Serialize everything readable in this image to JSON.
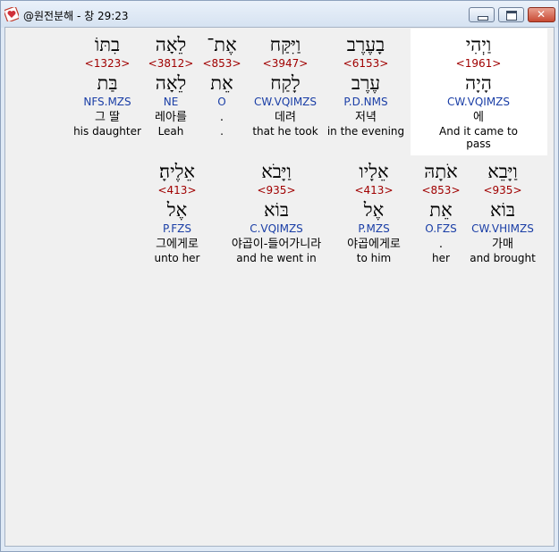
{
  "window": {
    "title": "@원전분해 - 창 29:23",
    "icon": "app-heart-icon"
  },
  "rows": [
    [
      {
        "id": "w1",
        "heb": "וַיְהִי",
        "num": "<1961>",
        "heb_root": "הָיָה",
        "morph": "CW.VQIMZS",
        "kor": "에",
        "eng": "And it came to pass"
      },
      {
        "id": "w2",
        "heb": "בָעֶרֶב",
        "num": "<6153>",
        "heb_root": "עֶרֶב",
        "morph": "P.D.NMS",
        "kor": "저녁",
        "eng": "in the evening"
      },
      {
        "id": "w3",
        "heb": "וַיִּקַּח",
        "num": "<3947>",
        "heb_root": "לָקַח",
        "morph": "CW.VQIMZS",
        "kor": "데려",
        "eng": "that he took"
      },
      {
        "id": "w4",
        "heb": "אֶת־",
        "num": "<853>",
        "heb_root": "אֵת",
        "morph": "O",
        "kor": ".",
        "eng": "."
      },
      {
        "id": "w5",
        "heb": "לֵאָה",
        "num": "<3812>",
        "heb_root": "לֵאָה",
        "morph": "NE",
        "kor": "레아를",
        "eng": "Leah"
      },
      {
        "id": "w6",
        "heb": "בִתּוֹ",
        "num": "<1323>",
        "heb_root": "בַּת",
        "morph": "NFS.MZS",
        "kor": "그 딸",
        "eng": "his daughter"
      }
    ],
    [
      {
        "id": "w7",
        "heb": "וַיָּבֵא",
        "num": "<935>",
        "heb_root": "בּוֹא",
        "morph": "CW.VHIMZS",
        "kor": "가매",
        "eng": "and brought"
      },
      {
        "id": "w8",
        "heb": "אֹתָהּ",
        "num": "<853>",
        "heb_root": "אֵת",
        "morph": "O.FZS",
        "kor": ".",
        "eng": "her"
      },
      {
        "id": "w9",
        "heb": "אֵלָיו",
        "num": "<413>",
        "heb_root": "אֶל",
        "morph": "P.MZS",
        "kor": "야곱에게로",
        "eng": "to him"
      },
      {
        "id": "w10",
        "heb": "וַיָּבֹא",
        "num": "<935>",
        "heb_root": "בּוֹא",
        "morph": "C.VQIMZS",
        "kor": "야곱이-들어가니라",
        "eng": "and he went in"
      },
      {
        "id": "w11",
        "heb": "אֵלֶיהָ׃",
        "num": "<413>",
        "heb_root": "אֶל",
        "morph": "P.FZS",
        "kor": "그에게로",
        "eng": "unto her"
      }
    ]
  ],
  "colors": {
    "number": "#a00000",
    "morph": "#1a3ea6",
    "highlight": "#ffffff"
  }
}
